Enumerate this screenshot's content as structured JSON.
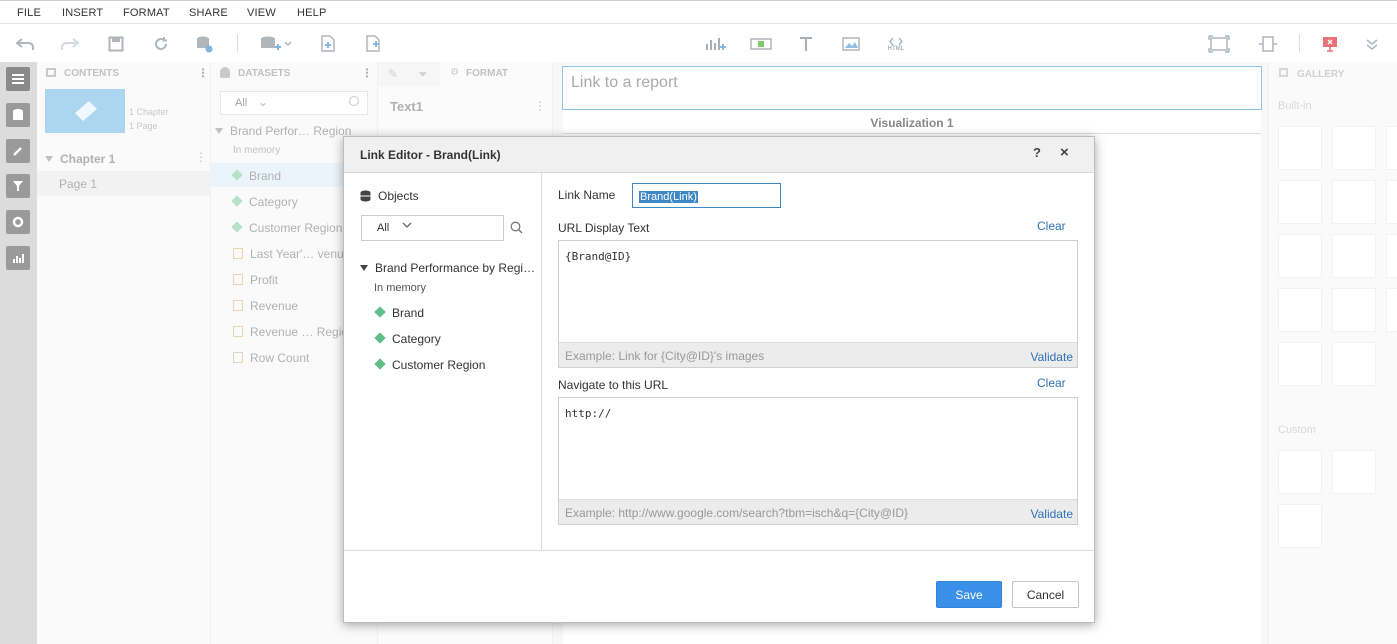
{
  "menu": [
    "FILE",
    "INSERT",
    "FORMAT",
    "SHARE",
    "VIEW",
    "HELP"
  ],
  "toolbar": {
    "icons": [
      "undo-icon",
      "redo-icon",
      "save-icon",
      "refresh-icon",
      "add-data-icon",
      "add-dataset-icon",
      "duplicate-page-icon",
      "add-page-icon",
      "insert-visualization-icon",
      "insert-filter-icon",
      "insert-text-icon",
      "insert-image-icon",
      "insert-html-icon",
      "presentation-mode-icon",
      "fit-icon",
      "notification-icon",
      "collapse-toolbar-icon"
    ],
    "html_label": "HTML"
  },
  "contents_panel": {
    "title": "CONTENTS",
    "thumb_line1": "1 Chapter",
    "thumb_line2": "1 Page",
    "chapter": "Chapter 1",
    "page": "Page 1"
  },
  "datasets_panel": {
    "title": "DATASETS",
    "filter": "All",
    "dataset_name": "Brand Perfor… Region",
    "storage": "In memory",
    "attributes": [
      "Brand",
      "Category",
      "Customer Region"
    ],
    "metrics": [
      "Last Year'… venue",
      "Profit",
      "Revenue",
      "Revenue … Region",
      "Row Count"
    ]
  },
  "format_panel": {
    "tab": "FORMAT",
    "selected": "Text1"
  },
  "canvas": {
    "link_placeholder": "Link to a report",
    "viz_title": "Visualization 1"
  },
  "gallery": {
    "title": "GALLERY",
    "builtin_label": "Built-in",
    "custom_label": "Custom"
  },
  "dialog": {
    "title": "Link Editor - Brand(Link)",
    "help": "?",
    "close": "×",
    "objects": {
      "label": "Objects",
      "filter": "All",
      "dataset": "Brand Performance by Regi…",
      "storage": "In memory",
      "attributes": [
        "Brand",
        "Category",
        "Customer Region"
      ]
    },
    "link_name_label": "Link Name",
    "link_name_value": "Brand(Link)",
    "url_display": {
      "label": "URL Display Text",
      "clear": "Clear",
      "value": "{Brand@ID}",
      "example": "Example: Link for {City@ID}'s images",
      "validate": "Validate"
    },
    "navigate_url": {
      "label": "Navigate to this URL",
      "clear": "Clear",
      "value": "http://",
      "example": "Example: http://www.google.com/search?tbm=isch&q={City@ID}",
      "validate": "Validate"
    },
    "save": "Save",
    "cancel": "Cancel"
  },
  "colors": {
    "accent": "#3a8fe8",
    "link": "#2f72b8",
    "attribute": "#5fbf86",
    "metric": "#e0a050"
  }
}
